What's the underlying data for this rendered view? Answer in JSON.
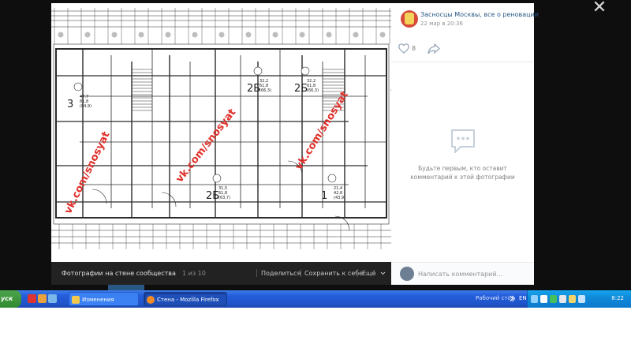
{
  "viewer": {
    "close_glyph": "✕",
    "footer": {
      "album_label": "Фотографии на стене сообщества",
      "counter": "1 из 10",
      "share_label": "Поделиться",
      "save_label": "Сохранить к себе",
      "more_label": "Ещё",
      "more_icon": "chevron-down-icon"
    },
    "photo": {
      "watermark_text": "vk.com/snosyat",
      "room_labels": [
        {
          "type": "3",
          "area": "47,7 81,8 (84,9)"
        },
        {
          "type": "2Б",
          "area": "32,2 61,8 (66,3)"
        },
        {
          "type": "2Б",
          "area": "32,2 61,8 (66,3)"
        },
        {
          "type": "2Б",
          "area": "31,5 61,8 (63,7)"
        },
        {
          "type": "1",
          "area": "21,4 42,8 (43,9)"
        }
      ]
    }
  },
  "side": {
    "community_name": "Засносцы Москвы, все о реновации",
    "date": "22 мар в 20:36",
    "likes_count": "8",
    "empty_comments_text": "Будьте первым, кто оставит комментарий к этой фотографии",
    "comment_placeholder": "Написать комментарий..."
  },
  "taskbar": {
    "start_label": "уск",
    "tasks": [
      {
        "label": "Изменения"
      },
      {
        "label": "Стена - Mozilla Firefox"
      }
    ],
    "desktop_label": "Рабочий стол",
    "language": "EN",
    "clock": "8:22"
  },
  "colors": {
    "link": "#2a5885",
    "watermark": "#e0302a",
    "taskbar": "#245edb",
    "start": "#3c9a3c"
  }
}
